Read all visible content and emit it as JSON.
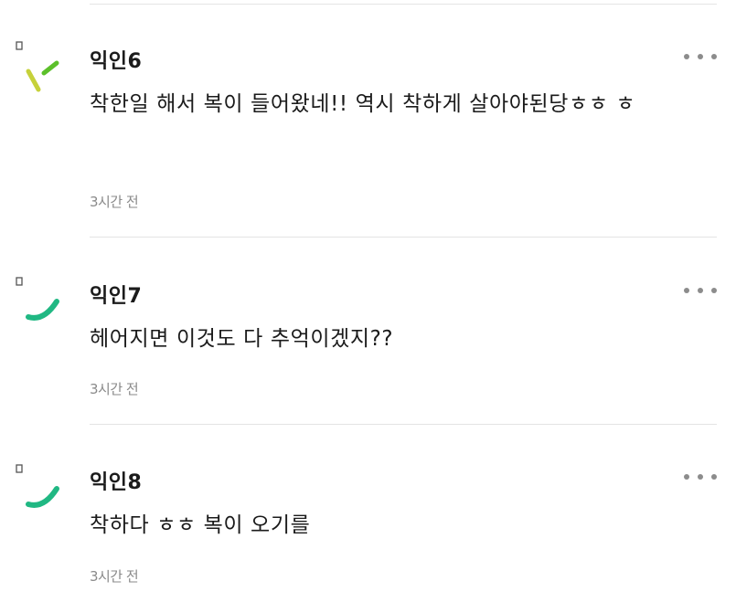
{
  "comments": [
    {
      "author": "익인6",
      "text": "착한일 해서 복이 들어왔네!! 역시 착하게 살아야된당ㅎㅎ ㅎ",
      "time": "3시간 전",
      "avatar_icon": "sprout-icon",
      "avatar_colors": [
        "#c6d13a",
        "#5cc02a"
      ]
    },
    {
      "author": "익인7",
      "text": "헤어지면 이것도 다 추억이겠지??",
      "time": "3시간 전",
      "avatar_icon": "smile-arc-icon",
      "avatar_colors": [
        "#20b883"
      ]
    },
    {
      "author": "익인8",
      "text": "착하다 ㅎㅎ 복이 오기를",
      "time": "3시간 전",
      "avatar_icon": "smile-arc-icon",
      "avatar_colors": [
        "#20b883"
      ]
    }
  ],
  "more_icon": "more-horizontal-icon"
}
